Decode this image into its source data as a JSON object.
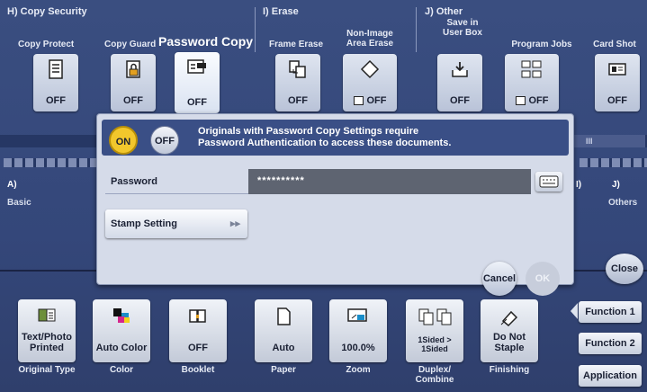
{
  "sections": {
    "copy_security": "H)  Copy Security",
    "erase": "I)  Erase",
    "other": "J)  Other"
  },
  "top_tiles": [
    {
      "label": "Copy Protect",
      "value": "OFF",
      "icon": "copy-protect-icon"
    },
    {
      "label": "Copy Guard",
      "value": "OFF",
      "icon": "copy-guard-icon"
    },
    {
      "label": "Password Copy",
      "value": "OFF",
      "icon": "password-copy-icon"
    },
    {
      "label": "Frame Erase",
      "value": "OFF",
      "icon": "frame-erase-icon"
    },
    {
      "label": "Non-Image\nArea Erase",
      "value": "OFF",
      "icon": "non-image-erase-icon"
    },
    {
      "label": "Save in\nUser Box",
      "value": "OFF",
      "icon": "save-box-icon"
    },
    {
      "label": "Program Jobs",
      "value": "OFF",
      "icon": "program-jobs-icon"
    },
    {
      "label": "Card Shot",
      "value": "OFF",
      "icon": "card-shot-icon"
    }
  ],
  "left_panel": {
    "letter": "A)",
    "label": "Basic"
  },
  "right_panel": {
    "letter_left": "I)",
    "letter": "J)",
    "label": "Others",
    "roman": "III"
  },
  "dialog": {
    "on_label": "ON",
    "off_label": "OFF",
    "message_line1": "Originals with Password Copy Settings require",
    "message_line2": "Password Authentication to access these documents.",
    "password_label": "Password",
    "password_value": "**********",
    "stamp_label": "Stamp Setting",
    "cancel_label": "Cancel",
    "ok_label": "OK"
  },
  "close_label": "Close",
  "bottom_tiles": [
    {
      "value": "Text/Photo\nPrinted",
      "label": "Original Type"
    },
    {
      "value": "Auto Color",
      "label": "Color"
    },
    {
      "value": "OFF",
      "label": "Booklet"
    },
    {
      "value": "Auto",
      "label": "Paper"
    },
    {
      "value": "100.0%",
      "label": "Zoom"
    },
    {
      "value": "1Sided >\n1Sided",
      "label": "Duplex/\nCombine"
    },
    {
      "value": "Do Not\nStaple",
      "label": "Finishing"
    }
  ],
  "side_buttons": [
    "Function 1",
    "Function 2",
    "Application"
  ],
  "colors": {
    "accent_yellow": "#f2c72c",
    "panel_blue": "#32457a",
    "dialog_bg": "#d5dbe9"
  }
}
